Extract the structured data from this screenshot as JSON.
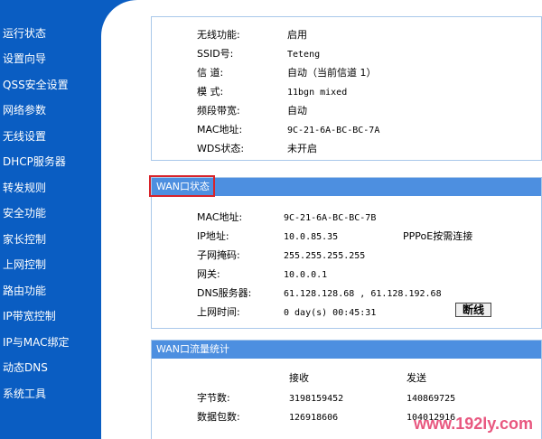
{
  "sidebar": {
    "items": [
      "运行状态",
      "设置向导",
      "QSS安全设置",
      "网络参数",
      "无线设置",
      "DHCP服务器",
      "转发规则",
      "安全功能",
      "家长控制",
      "上网控制",
      "路由功能",
      "IP带宽控制",
      "IP与MAC绑定",
      "动态DNS",
      "系统工具"
    ]
  },
  "wireless": {
    "rows": [
      {
        "label": "无线功能:",
        "value": "启用"
      },
      {
        "label": "SSID号:",
        "value": "Teteng"
      },
      {
        "label": "信 道:",
        "value": "自动（当前信道 1）"
      },
      {
        "label": "模 式:",
        "value": "11bgn mixed"
      },
      {
        "label": "频段带宽:",
        "value": "自动"
      },
      {
        "label": "MAC地址:",
        "value": "9C-21-6A-BC-BC-7A"
      },
      {
        "label": "WDS状态:",
        "value": "未开启"
      }
    ]
  },
  "wan": {
    "title": "WAN口状态",
    "rows": [
      {
        "label": "MAC地址:",
        "value": "9C-21-6A-BC-BC-7B"
      },
      {
        "label": "IP地址:",
        "value": "10.0.85.35"
      },
      {
        "label": "子网掩码:",
        "value": "255.255.255.255"
      },
      {
        "label": "网关:",
        "value": "10.0.0.1"
      },
      {
        "label": "DNS服务器:",
        "value": "61.128.128.68 , 61.128.192.68"
      },
      {
        "label": "上网时间:",
        "value": "0 day(s) 00:45:31"
      }
    ],
    "ip_note": "PPPoE按需连接",
    "disconnect_label": "断线"
  },
  "traffic": {
    "title": "WAN口流量统计",
    "col_recv": "接收",
    "col_send": "发送",
    "rows": [
      {
        "label": "字节数:",
        "recv": "3198159452",
        "send": "140869725"
      },
      {
        "label": "数据包数:",
        "recv": "126918606",
        "send": "104012916"
      }
    ]
  },
  "watermark": "www.192ly.com"
}
